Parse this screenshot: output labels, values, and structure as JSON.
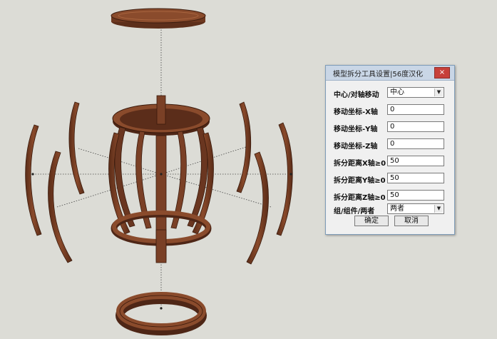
{
  "dialog": {
    "title": "模型拆分工具设置|56度汉化",
    "close_label": "×",
    "rows": [
      {
        "label": "中心/对轴移动",
        "value": "中心",
        "type": "select"
      },
      {
        "label": "移动坐标-X轴",
        "value": "0",
        "type": "input"
      },
      {
        "label": "移动坐标-Y轴",
        "value": "0",
        "type": "input"
      },
      {
        "label": "移动坐标-Z轴",
        "value": "0",
        "type": "input"
      },
      {
        "label": "拆分距离X轴≥0",
        "value": "50",
        "type": "input"
      },
      {
        "label": "拆分距离Y轴≥0",
        "value": "50",
        "type": "input"
      },
      {
        "label": "拆分距离Z轴≥0",
        "value": "50",
        "type": "input"
      },
      {
        "label": "组/组件/两者",
        "value": "两者",
        "type": "select"
      }
    ],
    "ok_label": "确定",
    "cancel_label": "取消"
  },
  "colors": {
    "wood": "#7a4026",
    "wood_dark": "#4e2616",
    "background": "#dcdcd6",
    "titlebar": "#c9d6e6",
    "close": "#c7403a"
  }
}
